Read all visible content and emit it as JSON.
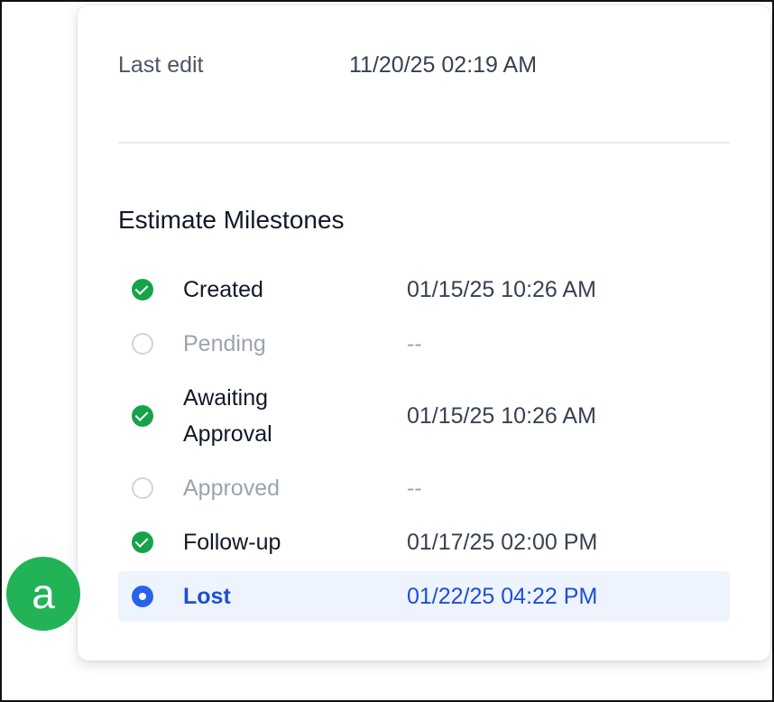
{
  "details": {
    "last_edit_label": "Last edit",
    "last_edit_value": "11/20/25 02:19 AM"
  },
  "milestones": {
    "title": "Estimate Milestones",
    "items": [
      {
        "label": "Created",
        "date": "01/15/25 10:26 AM",
        "status": "done",
        "icon": "check-circle-icon"
      },
      {
        "label": "Pending",
        "date": "--",
        "status": "pending",
        "icon": "empty-circle-icon"
      },
      {
        "label_line1": "Awaiting",
        "label_line2": "Approval",
        "date": "01/15/25 10:26 AM",
        "status": "done",
        "icon": "check-circle-icon"
      },
      {
        "label": "Approved",
        "date": "--",
        "status": "pending",
        "icon": "empty-circle-icon"
      },
      {
        "label": "Follow-up",
        "date": "01/17/25 02:00 PM",
        "status": "done",
        "icon": "check-circle-icon"
      },
      {
        "label": "Lost",
        "date": "01/22/25 04:22 PM",
        "status": "current",
        "icon": "radio-selected-icon"
      }
    ]
  },
  "annotation": {
    "marker_label": "a"
  },
  "colors": {
    "done": "#16a34a",
    "current": "#2563eb",
    "current_bg": "#eef4fd",
    "pending": "#9ca3af",
    "marker": "#22b357"
  }
}
